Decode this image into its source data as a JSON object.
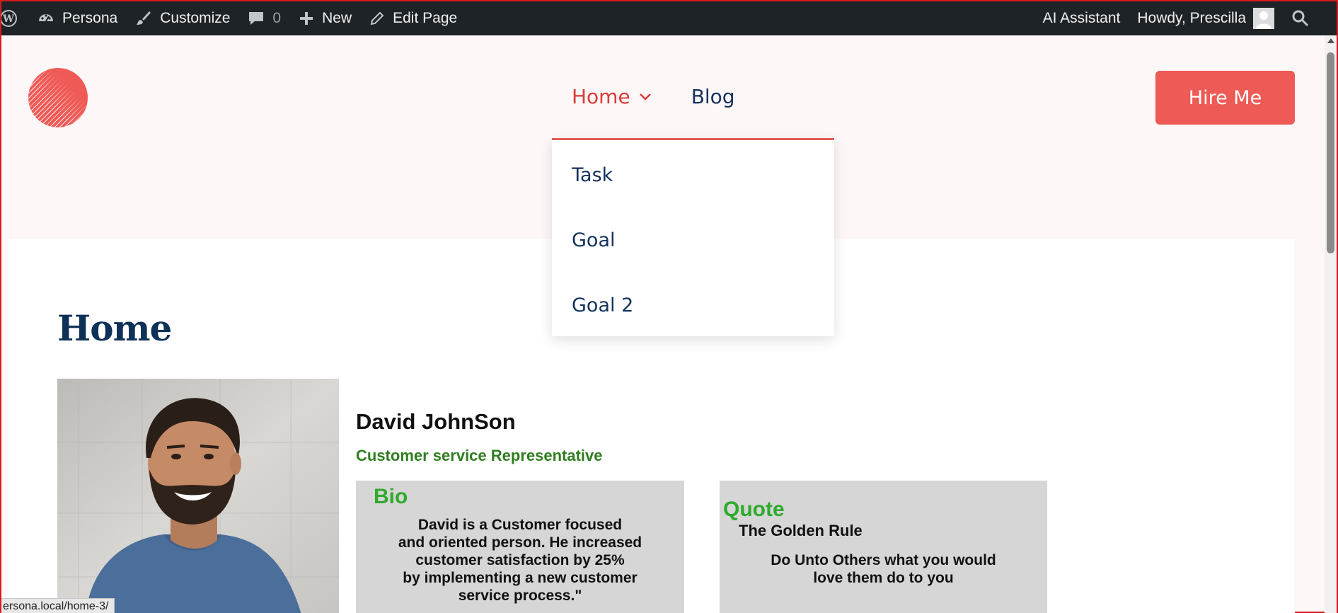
{
  "admin_bar": {
    "site_name": "Persona",
    "customize": "Customize",
    "comments_count": "0",
    "new": "New",
    "edit_page": "Edit Page",
    "ai_assistant": "AI Assistant",
    "howdy": "Howdy, Prescilla"
  },
  "nav": {
    "items": [
      {
        "label": "Home",
        "active": true,
        "has_dropdown": true
      },
      {
        "label": "Blog",
        "active": false
      }
    ],
    "dropdown": [
      "Task",
      "Goal",
      "Goal 2"
    ]
  },
  "header": {
    "hire_button": "Hire Me"
  },
  "page": {
    "title": "Home",
    "person_name": "David JohnSon",
    "person_role": "Customer service Representative",
    "bio": {
      "title": "Bio",
      "lines": [
        "David is a  Customer focused",
        "and oriented person. He increased",
        "customer satisfaction by 25%",
        "by implementing a new customer",
        "service process.\""
      ]
    },
    "quote": {
      "title": "Quote",
      "subtitle": "The Golden Rule",
      "lines": [
        "Do Unto Others what you would",
        "love them do to you"
      ]
    }
  },
  "status_bar": {
    "url": "ersona.local/home-3/"
  },
  "colors": {
    "accent": "#ee5a55",
    "nav_text": "#14335e",
    "admin_bg": "#1d2327",
    "bio_title": "#2eaa2c",
    "role_text": "#2f7d1f"
  }
}
